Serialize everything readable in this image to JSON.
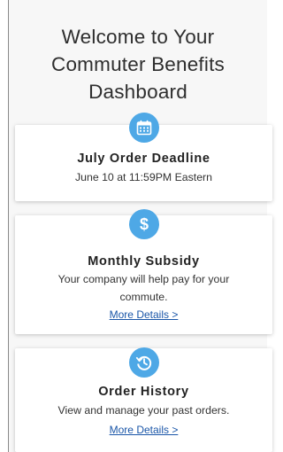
{
  "page": {
    "title_lines": [
      "Welcome to Your",
      "Commuter Benefits",
      "Dashboard"
    ]
  },
  "cards": [
    {
      "icon": "calendar-icon",
      "title": "July Order Deadline",
      "description": "June 10 at 11:59PM Eastern"
    },
    {
      "icon": "dollar-icon",
      "title": "Monthly Subsidy",
      "description_lines": [
        "Your company will help pay for your",
        "commute."
      ],
      "link": "More Details >"
    },
    {
      "icon": "history-icon",
      "title": "Order History",
      "description": "View and manage your past orders.",
      "link": "More Details >"
    }
  ],
  "colors": {
    "accent": "#4ea8e6",
    "link": "#1a56a8",
    "card_bg": "#ffffff",
    "page_bg": "#f7f7f7"
  }
}
